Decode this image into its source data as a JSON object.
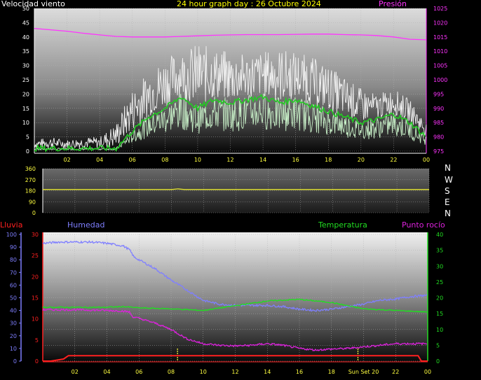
{
  "header": {
    "wind_title": "Velocidad viento",
    "graph_title": "24 hour graph day : 26 Octubre 2024",
    "pressure_title": "Presión"
  },
  "direction_labels": [
    "N",
    "W",
    "S",
    "E",
    "N"
  ],
  "bottom_header": {
    "rain": "Lluvia",
    "humidity": "Humedad",
    "temperature": "Temperatura",
    "dewpoint": "Punto rocío"
  },
  "colors": {
    "wind_title": "#ffffff",
    "graph_title": "#ffff00",
    "pressure": "#ff33ff",
    "gust": "#f2f2f2",
    "average": "#22cc22",
    "wind_speed": "#c8f0c8",
    "direction": "#e8e830",
    "rain": "#ff2020",
    "humidity": "#7f7fff",
    "temperature": "#22dd22",
    "dewpoint": "#dd22dd",
    "axis_yellow": "#ffff40",
    "sunset": "#ffff40"
  },
  "x_tick_labels": [
    "02",
    "04",
    "06",
    "08",
    "10",
    "12",
    "14",
    "16",
    "18",
    "20",
    "22",
    "00"
  ],
  "bottom_x_tick_labels": [
    "02",
    "04",
    "06",
    "08",
    "10",
    "12",
    "14",
    "16",
    "18",
    "Sun Set 20",
    "22",
    "00"
  ],
  "wind_chart": {
    "type": "line",
    "x_range_hours": [
      0,
      24
    ],
    "wind_axis": {
      "ticks": [
        "0",
        "5",
        "10",
        "15",
        "20",
        "25",
        "30",
        "35",
        "40",
        "45",
        "50"
      ],
      "range": [
        0,
        50
      ]
    },
    "pressure_axis": {
      "ticks": [
        "975",
        "980",
        "985",
        "990",
        "995",
        "1000",
        "1005",
        "1010",
        "1015",
        "1020",
        "1025"
      ],
      "range": [
        975,
        1025
      ]
    },
    "gust_envelope": [
      [
        0,
        4
      ],
      [
        1,
        5
      ],
      [
        2,
        4
      ],
      [
        3,
        5
      ],
      [
        4,
        5
      ],
      [
        5,
        10
      ],
      [
        6,
        22
      ],
      [
        7,
        28
      ],
      [
        8,
        33
      ],
      [
        9,
        35
      ],
      [
        10,
        38
      ],
      [
        11,
        36
      ],
      [
        12,
        35
      ],
      [
        13,
        34
      ],
      [
        14,
        35
      ],
      [
        15,
        36
      ],
      [
        16,
        35
      ],
      [
        17,
        33
      ],
      [
        18,
        30
      ],
      [
        19,
        26
      ],
      [
        20,
        22
      ],
      [
        21,
        20
      ],
      [
        22,
        22
      ],
      [
        23,
        18
      ],
      [
        24,
        10
      ]
    ],
    "average": [
      [
        0,
        1
      ],
      [
        1,
        1
      ],
      [
        2,
        1
      ],
      [
        3,
        1
      ],
      [
        4,
        1
      ],
      [
        5,
        1
      ],
      [
        6,
        7
      ],
      [
        7,
        12
      ],
      [
        8,
        15
      ],
      [
        9,
        19
      ],
      [
        10,
        15
      ],
      [
        11,
        18
      ],
      [
        12,
        17
      ],
      [
        13,
        18
      ],
      [
        14,
        19
      ],
      [
        15,
        17
      ],
      [
        16,
        18
      ],
      [
        17,
        16
      ],
      [
        18,
        14
      ],
      [
        19,
        12
      ],
      [
        20,
        10
      ],
      [
        21,
        11
      ],
      [
        22,
        13
      ],
      [
        23,
        10
      ],
      [
        24,
        5
      ]
    ],
    "pressure": [
      [
        0,
        1018
      ],
      [
        1,
        1017.5
      ],
      [
        2,
        1017
      ],
      [
        3,
        1016.3
      ],
      [
        4,
        1015.7
      ],
      [
        5,
        1015.2
      ],
      [
        6,
        1015
      ],
      [
        7,
        1015
      ],
      [
        8,
        1015
      ],
      [
        9,
        1015.2
      ],
      [
        10,
        1015.4
      ],
      [
        11,
        1015.6
      ],
      [
        12,
        1015.7
      ],
      [
        13,
        1015.8
      ],
      [
        14,
        1015.8
      ],
      [
        15,
        1015.8
      ],
      [
        16,
        1015.9
      ],
      [
        17,
        1016
      ],
      [
        18,
        1016
      ],
      [
        19,
        1015.8
      ],
      [
        20,
        1015.7
      ],
      [
        21,
        1015.5
      ],
      [
        22,
        1015
      ],
      [
        23,
        1014.2
      ],
      [
        24,
        1014
      ]
    ]
  },
  "direction_chart": {
    "type": "line",
    "y_ticks": [
      "0",
      "90",
      "180",
      "270",
      "360"
    ],
    "range": [
      0,
      360
    ],
    "values": [
      [
        0,
        190
      ],
      [
        8,
        190
      ],
      [
        8.4,
        195
      ],
      [
        8.8,
        190
      ],
      [
        24,
        190
      ]
    ]
  },
  "bottom_chart": {
    "type": "line",
    "rain_axis": {
      "ticks": [
        "0",
        "5",
        "10",
        "15",
        "20",
        "25",
        "30"
      ],
      "range": [
        0,
        30
      ]
    },
    "humidity_axis": {
      "ticks": [
        "0",
        "10",
        "20",
        "30",
        "40",
        "50",
        "60",
        "70",
        "80",
        "90",
        "100"
      ],
      "range": [
        0,
        100
      ]
    },
    "temp_axis": {
      "ticks": [
        "0",
        "5",
        "10",
        "15",
        "20",
        "25",
        "30",
        "35",
        "40"
      ],
      "range": [
        0,
        40
      ]
    },
    "rain": [
      [
        0,
        0
      ],
      [
        0.5,
        0
      ],
      [
        1.3,
        0.5
      ],
      [
        1.6,
        1.3
      ],
      [
        23.4,
        1.3
      ],
      [
        23.6,
        0
      ],
      [
        24,
        0
      ]
    ],
    "humidity": [
      [
        0,
        93
      ],
      [
        1,
        94
      ],
      [
        2,
        94
      ],
      [
        3,
        94
      ],
      [
        4,
        93
      ],
      [
        5,
        91
      ],
      [
        5.4,
        88
      ],
      [
        5.7,
        82
      ],
      [
        6,
        80
      ],
      [
        7,
        73
      ],
      [
        8,
        64
      ],
      [
        9,
        56
      ],
      [
        10,
        48
      ],
      [
        11,
        45
      ],
      [
        12,
        44
      ],
      [
        13,
        44
      ],
      [
        14,
        44
      ],
      [
        15,
        43
      ],
      [
        16,
        41
      ],
      [
        17,
        40
      ],
      [
        18,
        41
      ],
      [
        19,
        43
      ],
      [
        20,
        45
      ],
      [
        21,
        48
      ],
      [
        22,
        49
      ],
      [
        23,
        51
      ],
      [
        24,
        52
      ]
    ],
    "temperature": [
      [
        0,
        17
      ],
      [
        2,
        17
      ],
      [
        4,
        17
      ],
      [
        5,
        17.2
      ],
      [
        6,
        16.8
      ],
      [
        8,
        16.5
      ],
      [
        10,
        16
      ],
      [
        12,
        17.5
      ],
      [
        14,
        19
      ],
      [
        16,
        19.5
      ],
      [
        18,
        18.5
      ],
      [
        19,
        17.5
      ],
      [
        20,
        16.5
      ],
      [
        22,
        16
      ],
      [
        24,
        15.5
      ]
    ],
    "dewpoint": [
      [
        0,
        16.2
      ],
      [
        2,
        16.2
      ],
      [
        4,
        16
      ],
      [
        5,
        15.8
      ],
      [
        5.4,
        15.5
      ],
      [
        5.6,
        14
      ],
      [
        6,
        13.5
      ],
      [
        7,
        12
      ],
      [
        8,
        10
      ],
      [
        9,
        7
      ],
      [
        10,
        5.5
      ],
      [
        11,
        5
      ],
      [
        12,
        4.8
      ],
      [
        13,
        5
      ],
      [
        14,
        5.5
      ],
      [
        15,
        5
      ],
      [
        16,
        4
      ],
      [
        17,
        3.5
      ],
      [
        18,
        3.8
      ],
      [
        19,
        4
      ],
      [
        20,
        4.5
      ],
      [
        21,
        5
      ],
      [
        22,
        5.5
      ],
      [
        23,
        5.5
      ],
      [
        24,
        5.5
      ]
    ],
    "markers": [
      {
        "hour": 8.4
      },
      {
        "hour": 19.65
      }
    ]
  }
}
